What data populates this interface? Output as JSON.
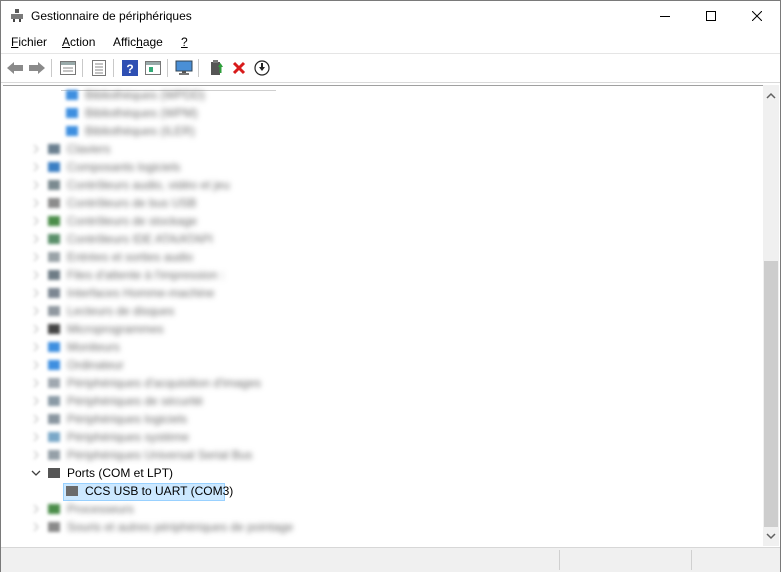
{
  "window": {
    "title": "Gestionnaire de périphériques"
  },
  "menu": {
    "items": [
      {
        "label_mnemonic": "F",
        "label_rest": "ichier"
      },
      {
        "label_mnemonic": "A",
        "label_rest": "ction"
      },
      {
        "label_prefix": "Affic",
        "label_mnemonic": "h",
        "label_rest": "age"
      },
      {
        "label_mnemonic": "?",
        "label_rest": ""
      }
    ]
  },
  "toolbar": {
    "icons": [
      "back-arrow-icon",
      "forward-arrow-icon",
      "properties-window-icon",
      "list-view-icon",
      "help-icon",
      "show-hidden-icon",
      "monitor-scan-icon",
      "update-driver-icon",
      "uninstall-x-icon",
      "download-icon"
    ]
  },
  "tree": {
    "blurred_top": [
      "Bibliothèques (WPDD)",
      "Bibliothèques (WPM)",
      "Bibliothèques (ILER)"
    ],
    "blurred_categories": [
      "Claviers",
      "Composants logiciels",
      "Contrôleurs audio, vidéo et jeu",
      "Contrôleurs de bus USB",
      "Contrôleurs de stockage",
      "Contrôleurs IDE ATA/ATAPI",
      "Entrées et sorties audio",
      "Files d'attente à l'impression :",
      "Interfaces Homme-machine",
      "Lecteurs de disques",
      "Microprogrammes",
      "Moniteurs",
      "Ordinateur",
      "Périphériques d'acquisition d'images",
      "Périphériques de sécurité",
      "Périphériques logiciels",
      "Périphériques système",
      "Périphériques Universal Serial Bus"
    ],
    "ports_label": "Ports (COM et LPT)",
    "ports_child": "CCS USB to UART (COM3)",
    "blurred_bottom": [
      "Processeurs",
      "Souris et autres périphériques de pointage"
    ]
  },
  "colors": {
    "selection_bg": "#cce8ff",
    "selection_border": "#99d1ff",
    "chrome_bg": "#f0f0f0"
  }
}
